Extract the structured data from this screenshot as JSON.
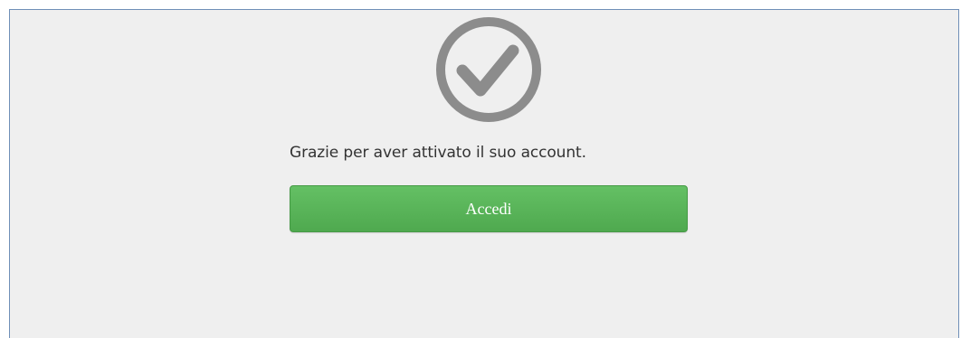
{
  "status": {
    "icon": "check-circle-icon",
    "icon_color": "#8a8a8a",
    "message": "Grazie per aver attivato il suo account."
  },
  "actions": {
    "login_label": "Accedi",
    "login_color": "#57b357"
  }
}
